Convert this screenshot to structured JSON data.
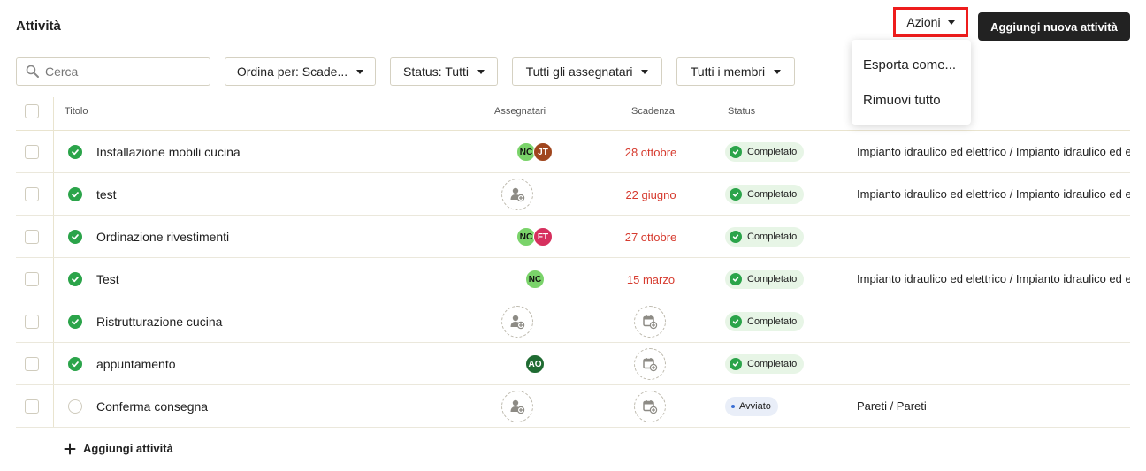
{
  "header": {
    "title": "Attività",
    "actions_label": "Azioni",
    "add_new_label": "Aggiungi nuova attività"
  },
  "actions_menu": {
    "items": [
      "Esporta come...",
      "Rimuovi tutto"
    ]
  },
  "filters": {
    "search_placeholder": "Cerca",
    "sort": "Ordina per: Scade...",
    "status": "Status: Tutti",
    "assignees": "Tutti gli assegnatari",
    "members": "Tutti i membri"
  },
  "table": {
    "columns": {
      "title": "Titolo",
      "assignees": "Assegnatari",
      "due": "Scadenza",
      "status": "Status"
    },
    "rows": [
      {
        "title": "Installazione mobili cucina",
        "due": "28 ottobre",
        "status": "Completato",
        "project": "Impianto idraulico ed elettrico / Impianto idraulico ed elettrico",
        "assignees": [
          "NC",
          "JT"
        ]
      },
      {
        "title": "test",
        "due": "22 giugno",
        "status": "Completato",
        "project": "Impianto idraulico ed elettrico / Impianto idraulico ed elettrico",
        "assignees": []
      },
      {
        "title": "Ordinazione rivestimenti",
        "due": "27 ottobre",
        "status": "Completato",
        "project": "",
        "assignees": [
          "NC",
          "FT"
        ]
      },
      {
        "title": "Test",
        "due": "15 marzo",
        "status": "Completato",
        "project": "Impianto idraulico ed elettrico / Impianto idraulico ed elettrico",
        "assignees": [
          "NC"
        ]
      },
      {
        "title": "Ristrutturazione cucina",
        "due": "",
        "status": "Completato",
        "project": "",
        "assignees": []
      },
      {
        "title": "appuntamento",
        "due": "",
        "status": "Completato",
        "project": "",
        "assignees": [
          "AO"
        ]
      },
      {
        "title": "Conferma consegna",
        "due": "",
        "status": "Avviato",
        "project": "Pareti / Pareti",
        "assignees": []
      }
    ]
  },
  "footer": {
    "add_task_label": "Aggiungi attività"
  },
  "colors": {
    "completed_green": "#2ba44a",
    "overdue_red": "#d63b2f",
    "highlight_red": "#ee1c1c",
    "avatar_nc": "#7ad36a",
    "avatar_jt": "#a0461e",
    "avatar_ft": "#d6305e",
    "avatar_ao": "#1f6b32"
  }
}
